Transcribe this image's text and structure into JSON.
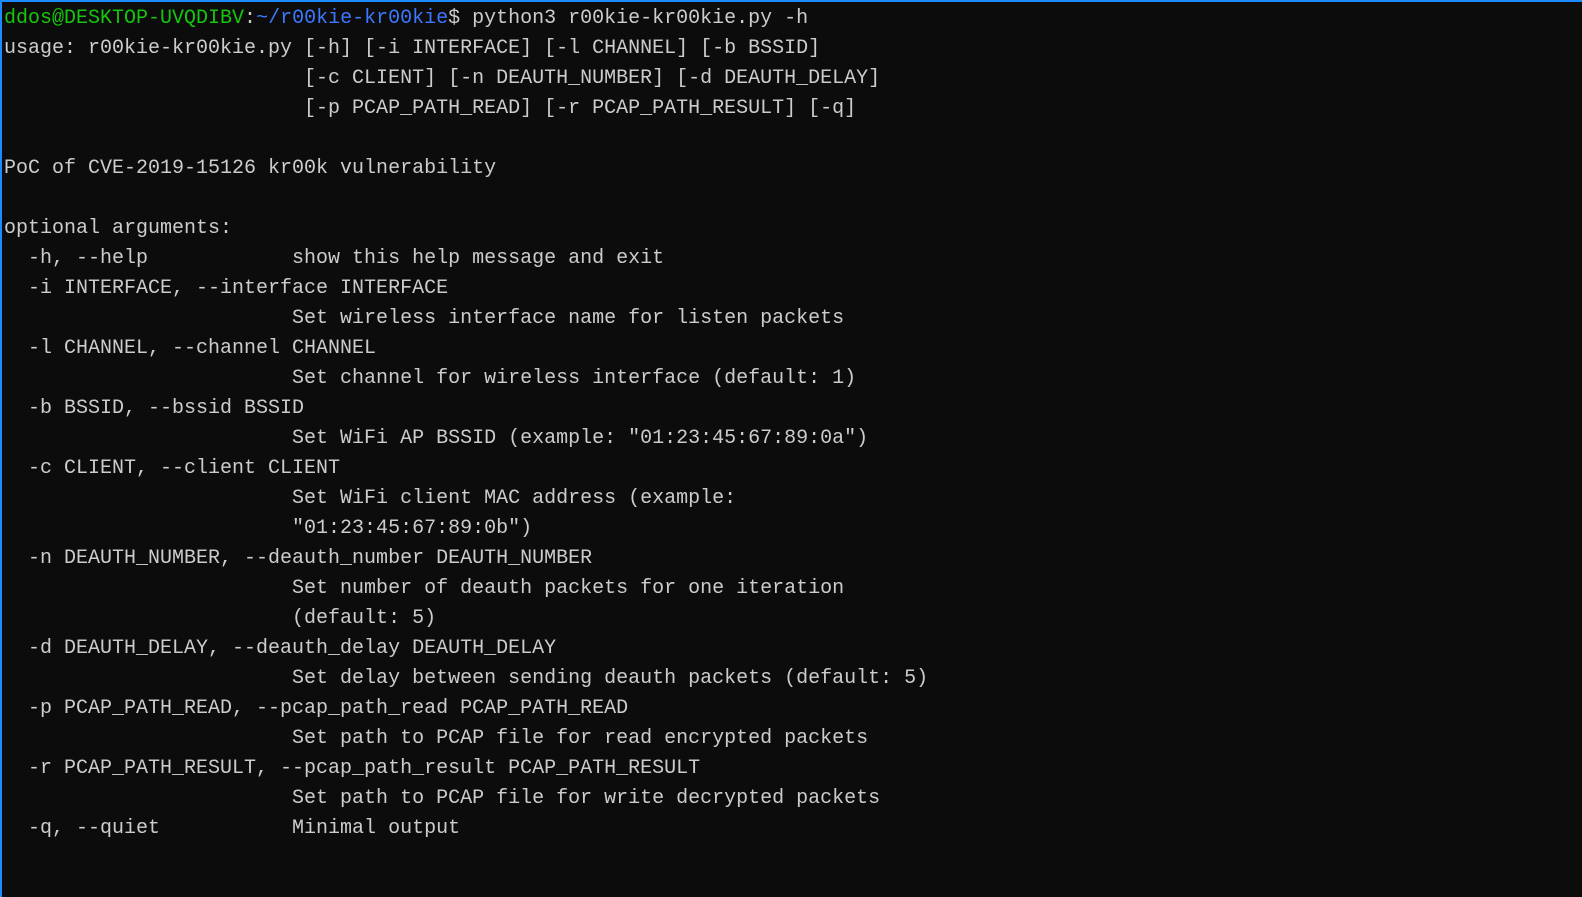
{
  "prompt": {
    "user": "ddos@DESKTOP-UVQDIBV",
    "colon": ":",
    "path": "~/r00kie-kr00kie",
    "dollar": "$ ",
    "command": "python3 r00kie-kr00kie.py -h"
  },
  "usage": {
    "line1": "usage: r00kie-kr00kie.py [-h] [-i INTERFACE] [-l CHANNEL] [-b BSSID]",
    "line2": "                         [-c CLIENT] [-n DEAUTH_NUMBER] [-d DEAUTH_DELAY]",
    "line3": "                         [-p PCAP_PATH_READ] [-r PCAP_PATH_RESULT] [-q]"
  },
  "description": "PoC of CVE-2019-15126 kr00k vulnerability",
  "optional_header": "optional arguments:",
  "args": {
    "help": "  -h, --help            show this help message and exit",
    "interface1": "  -i INTERFACE, --interface INTERFACE",
    "interface2": "                        Set wireless interface name for listen packets",
    "channel1": "  -l CHANNEL, --channel CHANNEL",
    "channel2": "                        Set channel for wireless interface (default: 1)",
    "bssid1": "  -b BSSID, --bssid BSSID",
    "bssid2": "                        Set WiFi AP BSSID (example: \"01:23:45:67:89:0a\")",
    "client1": "  -c CLIENT, --client CLIENT",
    "client2": "                        Set WiFi client MAC address (example:",
    "client3": "                        \"01:23:45:67:89:0b\")",
    "deauth_num1": "  -n DEAUTH_NUMBER, --deauth_number DEAUTH_NUMBER",
    "deauth_num2": "                        Set number of deauth packets for one iteration",
    "deauth_num3": "                        (default: 5)",
    "deauth_delay1": "  -d DEAUTH_DELAY, --deauth_delay DEAUTH_DELAY",
    "deauth_delay2": "                        Set delay between sending deauth packets (default: 5)",
    "pcap_read1": "  -p PCAP_PATH_READ, --pcap_path_read PCAP_PATH_READ",
    "pcap_read2": "                        Set path to PCAP file for read encrypted packets",
    "pcap_result1": "  -r PCAP_PATH_RESULT, --pcap_path_result PCAP_PATH_RESULT",
    "pcap_result2": "                        Set path to PCAP file for write decrypted packets",
    "quiet": "  -q, --quiet           Minimal output"
  }
}
